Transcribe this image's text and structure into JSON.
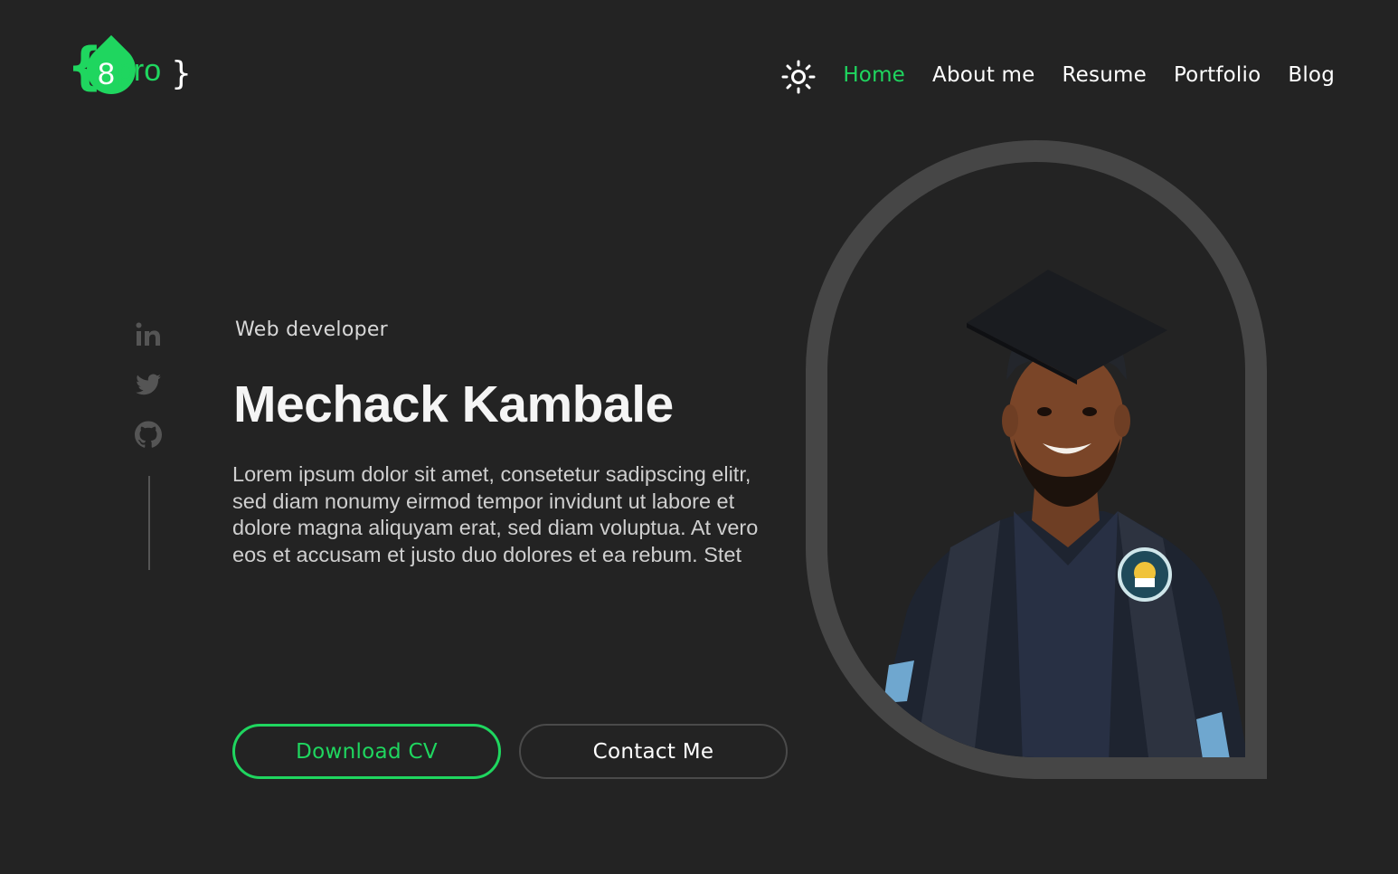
{
  "logo": {
    "brace_left": "{",
    "digit": "8",
    "pro": "pro",
    "brace_right": "}"
  },
  "header": {
    "theme_icon": "sun-icon",
    "nav": [
      {
        "label": "Home",
        "active": true
      },
      {
        "label": "About me",
        "active": false
      },
      {
        "label": "Resume",
        "active": false
      },
      {
        "label": "Portfolio",
        "active": false
      },
      {
        "label": "Blog",
        "active": false
      }
    ]
  },
  "social": {
    "icons": [
      "linkedin-icon",
      "twitter-icon",
      "github-icon"
    ]
  },
  "hero": {
    "role": "Web developer",
    "name": "Mechack Kambale",
    "bio": "Lorem ipsum dolor sit amet, consetetur sadipscing elitr, sed diam nonumy eirmod tempor invidunt ut labore et dolore magna aliquyam erat, sed diam voluptua. At vero eos et accusam et justo duo dolores et ea rebum. Stet",
    "download_label": "Download CV",
    "contact_label": "Contact Me"
  },
  "colors": {
    "background": "#232323",
    "accent": "#1fd65f",
    "text": "#ffffff",
    "frame": "#464646"
  }
}
